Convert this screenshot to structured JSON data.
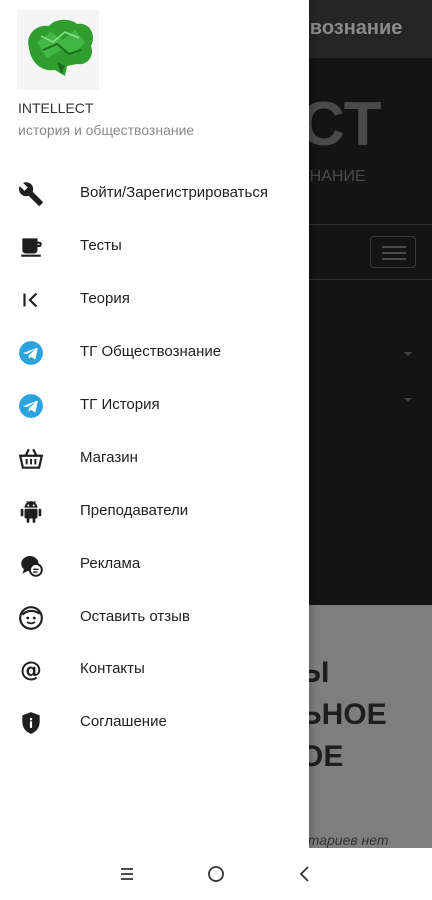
{
  "background": {
    "topbar_title": "твознание",
    "brand_partial": "CT",
    "subtitle_partial": "ЗНАНИЕ",
    "headings": [
      "Ы",
      "ЬНОЕ",
      "ОЕ"
    ],
    "comments_text": "нтариев нет"
  },
  "drawer": {
    "app_name": "INTELLECT",
    "app_subtitle": "история и обществознание",
    "items": [
      {
        "label": "Войти/Зарегистрироваться",
        "icon": "wrench-icon"
      },
      {
        "label": "Тесты",
        "icon": "coffee-cup-icon"
      },
      {
        "label": "Теория",
        "icon": "back-bracket-icon"
      },
      {
        "label": "ТГ Обществознание",
        "icon": "telegram-icon"
      },
      {
        "label": "ТГ История",
        "icon": "telegram-icon"
      },
      {
        "label": "Магазин",
        "icon": "basket-icon"
      },
      {
        "label": "Преподаватели",
        "icon": "android-icon"
      },
      {
        "label": "Реклама",
        "icon": "chat-bubbles-icon"
      },
      {
        "label": "Оставить отзыв",
        "icon": "face-icon"
      },
      {
        "label": "Контакты",
        "icon": "at-sign-icon"
      },
      {
        "label": "Соглашение",
        "icon": "shield-icon"
      }
    ]
  },
  "colors": {
    "telegram": "#2AA3DF",
    "drawer_bg": "#ffffff",
    "text": "#1f1f1f",
    "subtext": "#8a8a8a",
    "logo_green": "#2f9e2f"
  },
  "navbar": {
    "buttons": [
      "menu-icon",
      "home-circle-icon",
      "back-icon"
    ]
  }
}
